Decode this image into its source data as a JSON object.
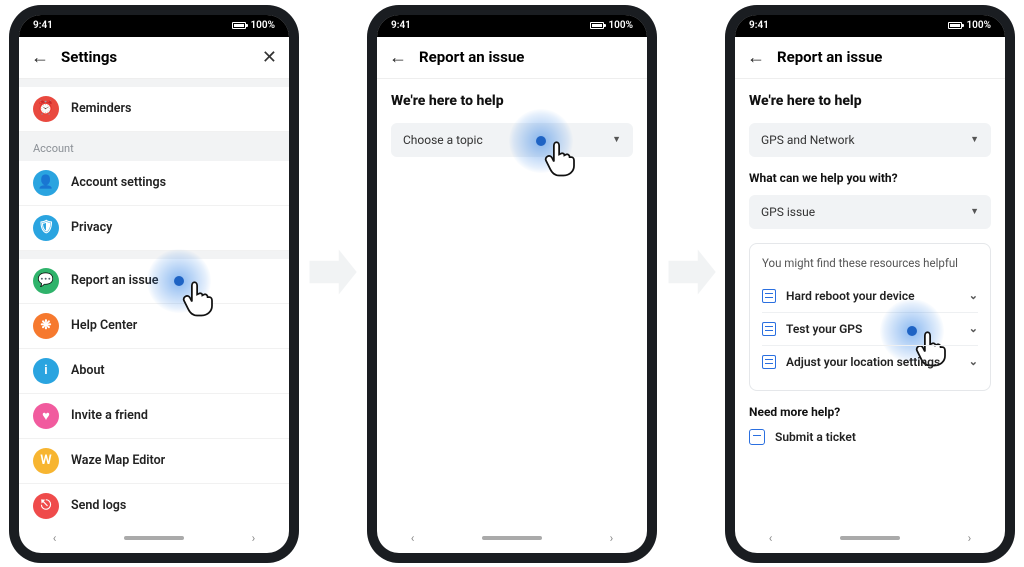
{
  "statusbar": {
    "time": "9:41",
    "battery": "100%"
  },
  "phone1": {
    "header": {
      "title": "Settings"
    },
    "rows": {
      "reminders": "Reminders",
      "section_account": "Account",
      "account_settings": "Account settings",
      "privacy": "Privacy",
      "report": "Report an issue",
      "help_center": "Help Center",
      "about": "About",
      "invite": "Invite a friend",
      "map_editor": "Waze Map Editor",
      "send_logs": "Send logs"
    }
  },
  "phone2": {
    "header": {
      "title": "Report an issue"
    },
    "heading": "We're here to help",
    "select_placeholder": "Choose a topic"
  },
  "phone3": {
    "header": {
      "title": "Report an issue"
    },
    "heading": "We're here to help",
    "topic_value": "GPS and Network",
    "subq": "What can we help you with?",
    "sub_value": "GPS issue",
    "resources_hdr": "You might find these resources helpful",
    "resources": {
      "r1": "Hard reboot your device",
      "r2": "Test your GPS",
      "r3": "Adjust your location settings"
    },
    "need_more": "Need more help?",
    "submit": "Submit a ticket"
  }
}
